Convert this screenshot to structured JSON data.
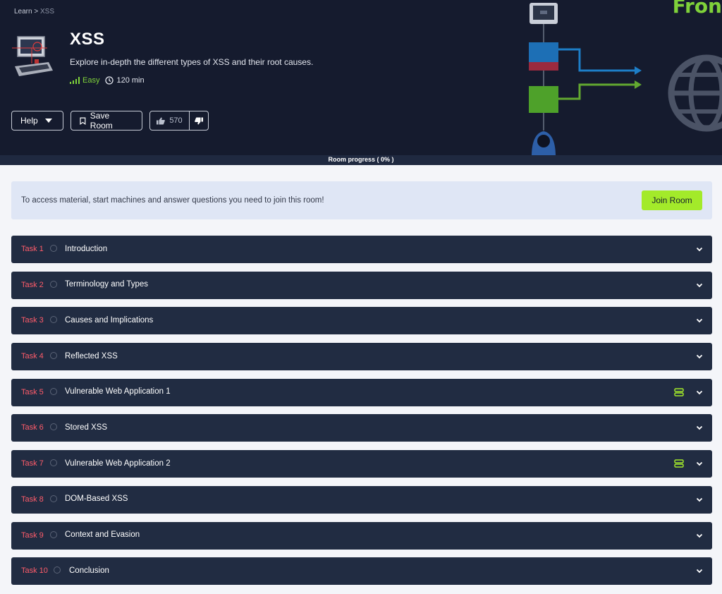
{
  "breadcrumb": {
    "root": "Learn",
    "separator": ">",
    "current": "XSS"
  },
  "room": {
    "title": "XSS",
    "description": "Explore in-depth the different types of XSS and their root causes.",
    "difficulty": "Easy",
    "duration": "120 min"
  },
  "actions": {
    "help_label": "Help",
    "save_label": "Save Room",
    "upvotes": "570"
  },
  "progress": {
    "label": "Room progress ( 0% )",
    "value": 0
  },
  "hero_art_text": "Fron",
  "notice": {
    "text": "To access material, start machines and answer questions you need to join this room!",
    "join_label": "Join Room"
  },
  "tasks": [
    {
      "num": "Task 1",
      "title": "Introduction",
      "has_machine": false
    },
    {
      "num": "Task 2",
      "title": "Terminology and Types",
      "has_machine": false
    },
    {
      "num": "Task 3",
      "title": "Causes and Implications",
      "has_machine": false
    },
    {
      "num": "Task 4",
      "title": "Reflected XSS",
      "has_machine": false
    },
    {
      "num": "Task 5",
      "title": "Vulnerable Web Application 1",
      "has_machine": true
    },
    {
      "num": "Task 6",
      "title": "Stored XSS",
      "has_machine": false
    },
    {
      "num": "Task 7",
      "title": "Vulnerable Web Application 2",
      "has_machine": true
    },
    {
      "num": "Task 8",
      "title": "DOM-Based XSS",
      "has_machine": false
    },
    {
      "num": "Task 9",
      "title": "Context and Evasion",
      "has_machine": false
    },
    {
      "num": "Task 10",
      "title": "Conclusion",
      "has_machine": false
    }
  ],
  "colors": {
    "hero_bg": "#151b2e",
    "task_bg": "#212c42",
    "task_number": "#ff5c6a",
    "accent_green": "#a3ea2a",
    "difficulty_green": "#7fd23a"
  }
}
